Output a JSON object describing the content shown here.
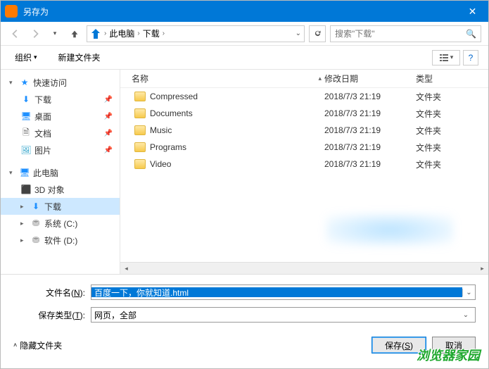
{
  "window": {
    "title": "另存为"
  },
  "nav": {
    "root": "此电脑",
    "current": "下载"
  },
  "search": {
    "placeholder": "搜索\"下载\""
  },
  "toolbar": {
    "organize": "组织",
    "newfolder": "新建文件夹"
  },
  "sidebar": {
    "quick": "快速访问",
    "downloads": "下载",
    "desktop": "桌面",
    "documents": "文档",
    "pictures": "图片",
    "thispc": "此电脑",
    "objects3d": "3D 对象",
    "downloads2": "下载",
    "sysdrive": "系统 (C:)",
    "swdrive": "软件 (D:)"
  },
  "columns": {
    "name": "名称",
    "date": "修改日期",
    "type": "类型"
  },
  "files": [
    {
      "name": "Compressed",
      "date": "2018/7/3 21:19",
      "type": "文件夹"
    },
    {
      "name": "Documents",
      "date": "2018/7/3 21:19",
      "type": "文件夹"
    },
    {
      "name": "Music",
      "date": "2018/7/3 21:19",
      "type": "文件夹"
    },
    {
      "name": "Programs",
      "date": "2018/7/3 21:19",
      "type": "文件夹"
    },
    {
      "name": "Video",
      "date": "2018/7/3 21:19",
      "type": "文件夹"
    }
  ],
  "form": {
    "filename_label": "文件名(N):",
    "filename_value": "百度一下，你就知道.html",
    "filetype_label": "保存类型(T):",
    "filetype_value": "网页，全部"
  },
  "footer": {
    "hide": "隐藏文件夹",
    "save": "保存(S)",
    "cancel": "取消"
  },
  "watermark": "浏览器家园"
}
